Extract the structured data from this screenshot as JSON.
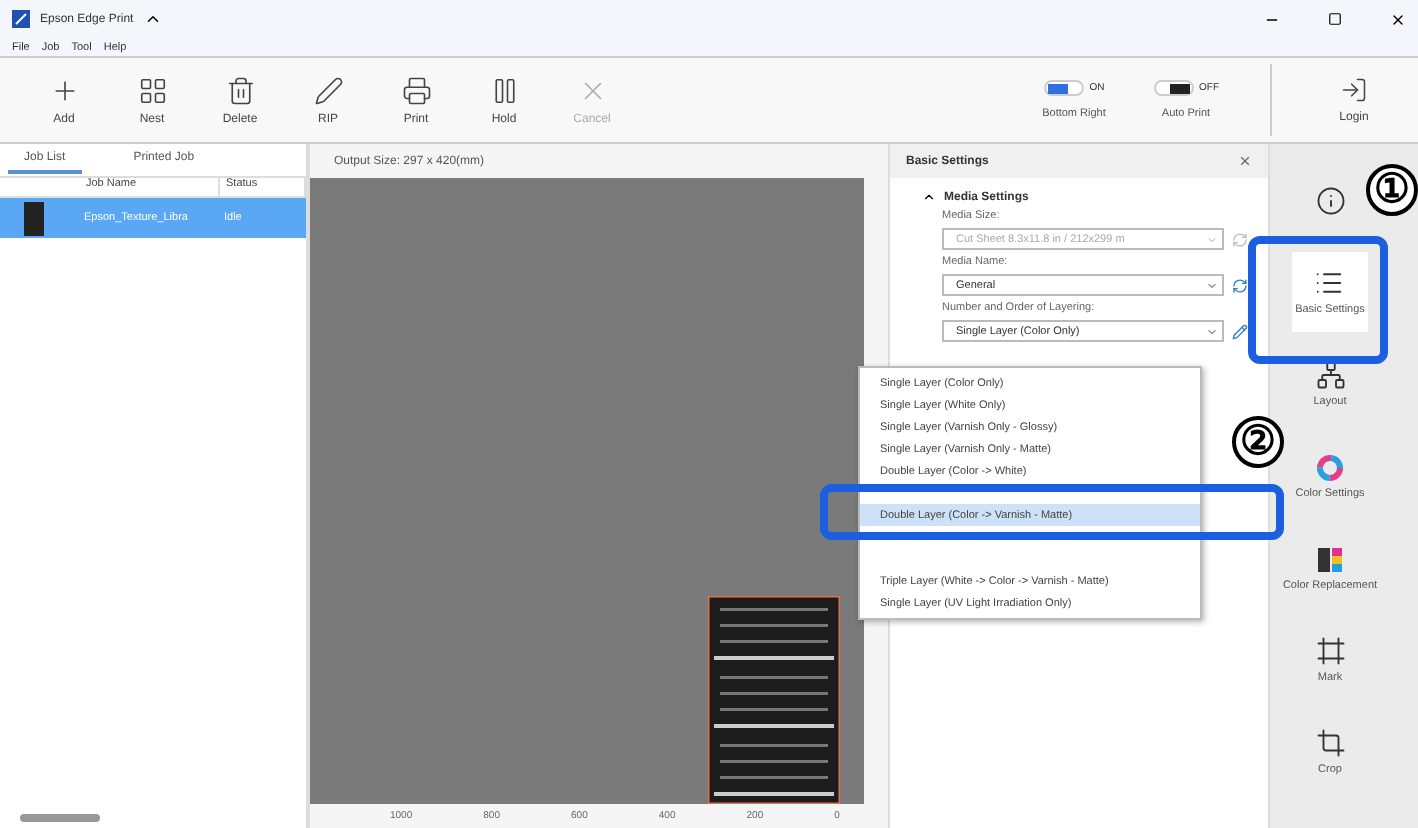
{
  "window": {
    "title": "Epson Edge Print"
  },
  "menu": [
    "File",
    "Job",
    "Tool",
    "Help"
  ],
  "toolbar": [
    {
      "label": "Add",
      "disabled": false
    },
    {
      "label": "Nest",
      "disabled": false
    },
    {
      "label": "Delete",
      "disabled": false
    },
    {
      "label": "RIP",
      "disabled": false
    },
    {
      "label": "Print",
      "disabled": false
    },
    {
      "label": "Hold",
      "disabled": false
    },
    {
      "label": "Cancel",
      "disabled": true
    }
  ],
  "toggles": [
    {
      "label": "Bottom Right",
      "state": "ON",
      "on": true
    },
    {
      "label": "Auto Print",
      "state": "OFF",
      "on": false
    }
  ],
  "login": "Login",
  "job_panel": {
    "tabs": [
      {
        "label": "Job List",
        "selected": true
      },
      {
        "label": "Printed Job",
        "selected": false
      }
    ],
    "columns": [
      "Job Name",
      "Status"
    ],
    "rows": [
      {
        "name": "Epson_Texture_Libra",
        "status": "Idle",
        "selected": true
      }
    ]
  },
  "canvas": {
    "output_size": "Output Size:  297 x 420(mm)",
    "ruler": [
      "1000",
      "800",
      "600",
      "400",
      "200",
      "0"
    ]
  },
  "settings": {
    "title": "Basic Settings",
    "section": "Media Settings",
    "expanded": true,
    "fields": [
      {
        "label": "Media Size:",
        "value": "Cut Sheet 8.3x11.8 in / 212x299 m",
        "disabled": true
      },
      {
        "label": "Media Name:",
        "value": "General",
        "disabled": false
      },
      {
        "label": "Number and Order of Layering:",
        "value": "Single Layer (Color Only)",
        "disabled": false
      }
    ],
    "options": [
      {
        "label": "Single Layer (Color Only)",
        "selected": false
      },
      {
        "label": "Single Layer (White Only)",
        "selected": false
      },
      {
        "label": "Single Layer (Varnish Only - Glossy)",
        "selected": false
      },
      {
        "label": "Single Layer (Varnish Only - Matte)",
        "selected": false
      },
      {
        "label": "Double Layer (Color -> White)",
        "selected": false
      },
      {
        "label": "Double Layer (Color -> Varnish - Matte)",
        "selected": true
      },
      {
        "label": "Triple Layer (White -> Color -> Varnish - Matte)",
        "selected": false
      },
      {
        "label": "Single Layer (UV Light Irradiation Only)",
        "selected": false
      }
    ]
  },
  "sidebar": [
    {
      "selected": false
    },
    {
      "label": "Basic Settings",
      "selected": true
    },
    {
      "label": "Layout",
      "selected": false
    },
    {
      "label": "Color Settings",
      "selected": false
    },
    {
      "label": "Color Replacement",
      "selected": false
    },
    {
      "label": "Mark",
      "selected": false
    },
    {
      "label": "Crop",
      "selected": false
    }
  ],
  "callouts": [
    "①",
    "②"
  ]
}
